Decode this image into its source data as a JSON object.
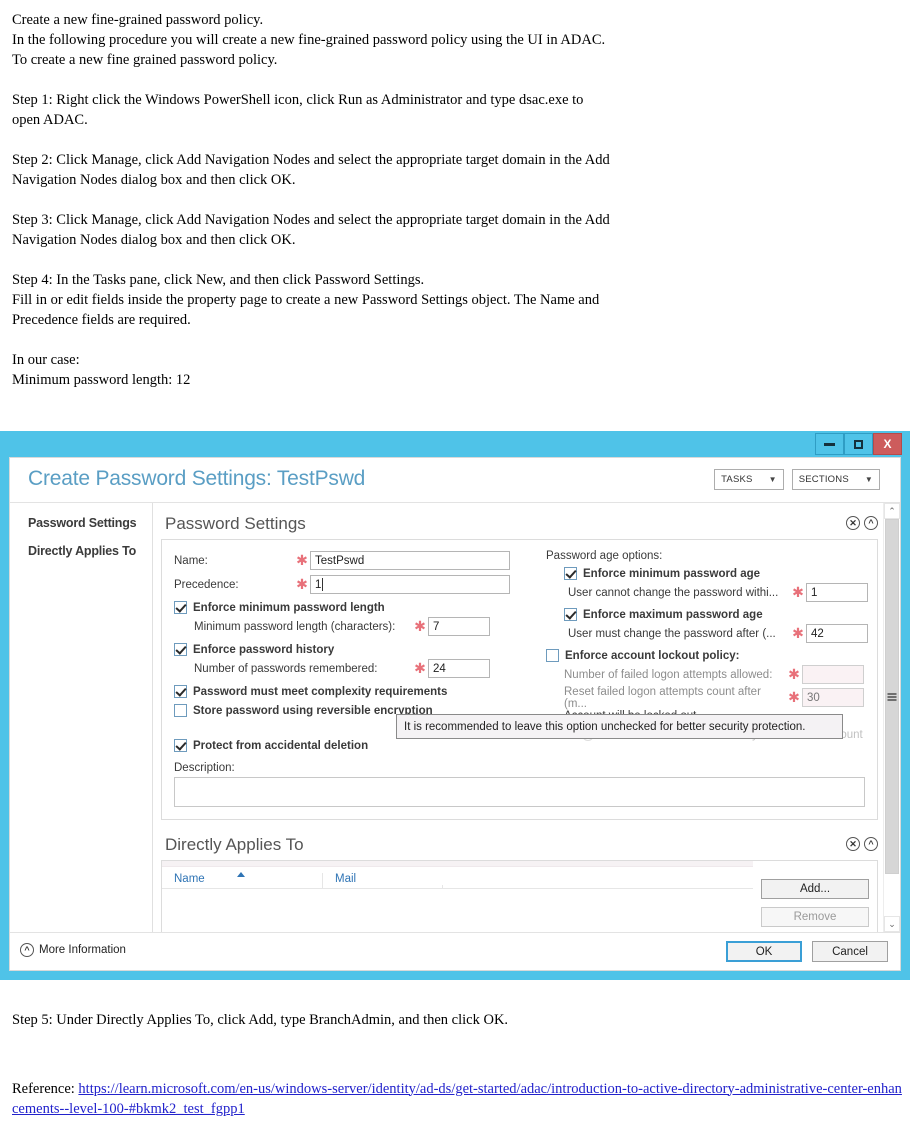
{
  "doc": {
    "intro": [
      "Create a new fine-grained password policy.",
      "In the following procedure you will create a new fine-grained password policy using the UI in ADAC.",
      "To create a new fine grained password policy."
    ],
    "step1": "Step 1: Right click the Windows PowerShell icon, click Run as Administrator and type dsac.exe to open ADAC.",
    "step2": "Step 2: Click Manage, click Add Navigation Nodes and select the appropriate target domain in the Add Navigation Nodes dialog box and then click OK.",
    "step3": "Step 3: Click Manage, click Add Navigation Nodes and select the appropriate target domain in the Add Navigation Nodes dialog box and then click OK.",
    "step4a": "Step 4: In the Tasks pane, click New, and then click Password Settings.",
    "step4b": "Fill in or edit fields inside the property page to create a new Password Settings object. The Name and Precedence fields are required.",
    "case_label": "In our case:",
    "case_value": "Minimum password length: 12",
    "step5": "Step 5: Under Directly Applies To, click Add, type BranchAdmin, and then click OK.",
    "reference_label": "Reference:",
    "reference_url": "https://learn.microsoft.com/en-us/windows-server/identity/ad-ds/get-started/adac/introduction-to-active-directory-administrative-center-enhancements--level-100-#bkmk2_test_fgpp1"
  },
  "window": {
    "title": "Create Password Settings: TestPswd",
    "minimize_label": "—",
    "maximize_label": "□",
    "close_label": "X",
    "tasks_label": "TASKS",
    "sections_label": "SECTIONS",
    "caret": "▼",
    "accent_color": "#4fc3e8",
    "title_color": "#5a9ec4",
    "close_color": "#cd5c5c",
    "required_color": "#e8717a"
  },
  "nav": {
    "items": [
      {
        "label": "Password Settings"
      },
      {
        "label": "Directly Applies To"
      }
    ]
  },
  "password_settings": {
    "section_title": "Password Settings",
    "close_icon": "✕",
    "collapse_icon": "^",
    "name_label": "Name:",
    "name_value": "TestPswd",
    "precedence_label": "Precedence:",
    "precedence_value": "1",
    "required_marker": "✱",
    "enforce_min_length_label": "Enforce minimum password length",
    "min_length_label": "Minimum password length (characters):",
    "min_length_value": "7",
    "enforce_history_label": "Enforce password history",
    "history_label": "Number of passwords remembered:",
    "history_value": "24",
    "complexity_label": "Password must meet complexity requirements",
    "reversible_label": "Store password using reversible encryption",
    "protect_label": "Protect from accidental deletion",
    "description_label": "Description:",
    "description_value": "",
    "age_group_label": "Password age options:",
    "enforce_min_age_label": "Enforce minimum password age",
    "min_age_label": "User cannot change the password withi...",
    "min_age_value": "1",
    "enforce_max_age_label": "Enforce maximum password age",
    "max_age_label": "User must change the password after (...",
    "max_age_value": "42",
    "lockout_label": "Enforce account lockout policy:",
    "failed_attempts_label": "Number of failed logon attempts allowed:",
    "failed_attempts_value": "",
    "reset_count_label": "Reset failed logon attempts count after (m...",
    "reset_count_value": "30",
    "locked_out_label": "Account will be locked out",
    "until_admin_label": "Until an administrator manually unlocks the account"
  },
  "tooltip": {
    "text": "It is recommended to leave this option unchecked for better security protection."
  },
  "directly_applies_to": {
    "section_title": "Directly Applies To",
    "close_icon": "✕",
    "collapse_icon": "^",
    "columns": [
      "Name",
      "Mail",
      ""
    ],
    "rows": [],
    "add_label": "Add...",
    "remove_label": "Remove"
  },
  "footer": {
    "more_information": "More Information",
    "more_info_icon": "^",
    "ok_label": "OK",
    "cancel_label": "Cancel"
  },
  "scrollbar": {
    "up_arrow": "⌃",
    "down_arrow": "⌄"
  }
}
